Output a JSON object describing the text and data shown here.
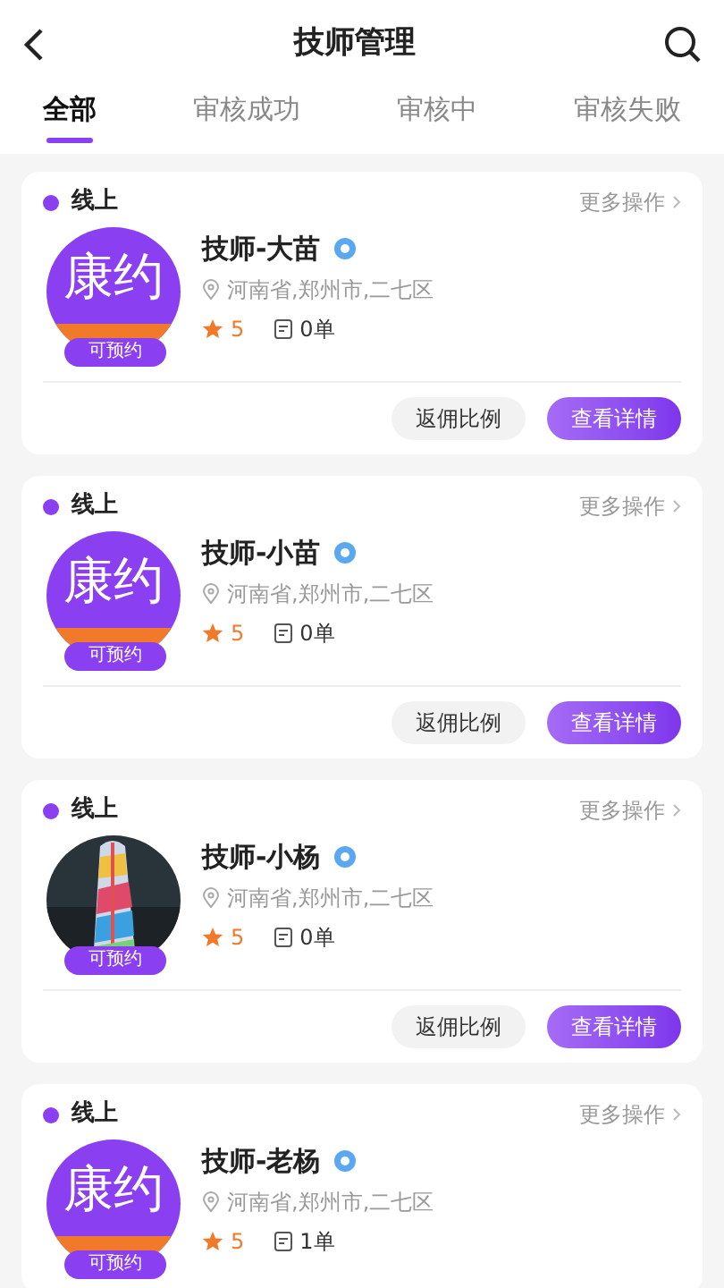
{
  "header": {
    "back_icon": true,
    "title": "技师管理",
    "search_icon": true
  },
  "tabs": [
    {
      "label": "全部",
      "selected": true
    },
    {
      "label": "审核成功",
      "selected": false
    },
    {
      "label": "审核中",
      "selected": false
    },
    {
      "label": "审核失败",
      "selected": false
    }
  ],
  "technicians": [
    {
      "status": "线上",
      "more": "更多操作",
      "avatar": {
        "kind": "logo",
        "text": "康约"
      },
      "badge": "可预约",
      "name": "技师-大苗",
      "verified": true,
      "location": "河南省,郑州市,二七区",
      "rating": "5",
      "orders": "0单",
      "buttons": [
        "返佣比例",
        "查看详情"
      ]
    },
    {
      "status": "线上",
      "more": "更多操作",
      "avatar": {
        "kind": "logo",
        "text": "康约"
      },
      "badge": "可预约",
      "name": "技师-小苗",
      "verified": true,
      "location": "河南省,郑州市,二七区",
      "rating": "5",
      "orders": "0单",
      "buttons": [
        "返佣比例",
        "查看详情"
      ]
    },
    {
      "status": "线上",
      "more": "更多操作",
      "badge": "可预约",
      "name": "技师-小杨",
      "verified": true,
      "location": "河南省,郑州市,二七区",
      "rating": "5",
      "orders": "0单",
      "buttons": [
        "返佣比例",
        "查看详情"
      ]
    },
    {
      "status": "线上",
      "more": "更多操作",
      "avatar": {
        "kind": "logo",
        "text": "康约"
      },
      "badge": "可预约",
      "name": "技师-老杨",
      "verified": true,
      "location": "河南省,郑州市,二七区",
      "rating": "5",
      "orders": "1单"
    }
  ]
}
